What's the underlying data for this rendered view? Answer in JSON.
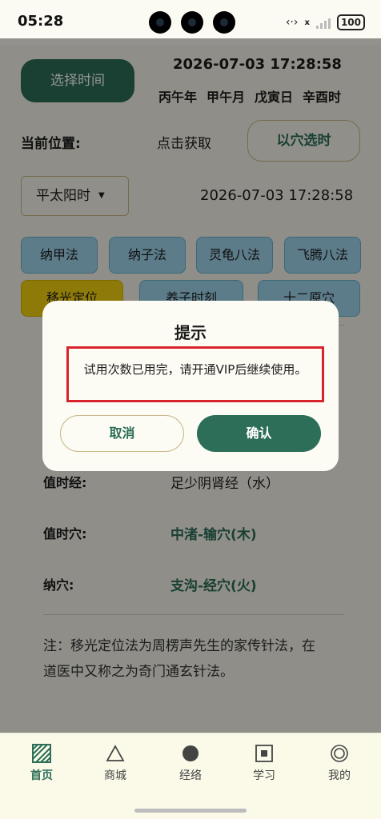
{
  "status_bar": {
    "time": "05:28",
    "battery": "100",
    "signal_text": "x"
  },
  "header": {
    "pick_time_label": "选择时间",
    "datetime": "2026-07-03 17:28:58",
    "ganzhi": [
      "丙午年",
      "甲午月",
      "戊寅日",
      "辛酉时"
    ]
  },
  "location": {
    "label": "当前位置:",
    "action": "点击获取",
    "xue_button": "以穴选时"
  },
  "time_mode": {
    "selected": "平太阳时",
    "datetime": "2026-07-03 17:28:58"
  },
  "methods": [
    {
      "label": "纳甲法",
      "active": false
    },
    {
      "label": "纳子法",
      "active": false
    },
    {
      "label": "灵龟八法",
      "active": false
    },
    {
      "label": "飞腾八法",
      "active": false
    },
    {
      "label": "移光定位",
      "active": true
    },
    {
      "label": "养子时刻",
      "active": false
    },
    {
      "label": "十二原穴",
      "active": false
    }
  ],
  "results": [
    {
      "label": "值时经:",
      "value": "足少阴肾经（水）"
    },
    {
      "label": "值时穴:",
      "value": "中渚-输穴(木)"
    },
    {
      "label": "纳穴:",
      "value": "支沟-经穴(火)"
    }
  ],
  "note": "注：移光定位法为周楞声先生的家传针法，在道医中又称之为奇门通玄针法。",
  "dialog": {
    "title": "提示",
    "message": "试用次数已用完，请开通VIP后继续使用。",
    "cancel": "取消",
    "confirm": "确认"
  },
  "tabs": [
    {
      "label": "首页",
      "icon": "home-grid-icon",
      "active": true
    },
    {
      "label": "商城",
      "icon": "triangle-icon",
      "active": false
    },
    {
      "label": "经络",
      "icon": "circle-icon",
      "active": false
    },
    {
      "label": "学习",
      "icon": "square-icon",
      "active": false
    },
    {
      "label": "我的",
      "icon": "target-icon",
      "active": false
    }
  ],
  "colors": {
    "primary": "#2c6e58",
    "chip": "#9fd6ee",
    "chip_active": "#f5d20e",
    "highlight_border": "#d9232a"
  }
}
